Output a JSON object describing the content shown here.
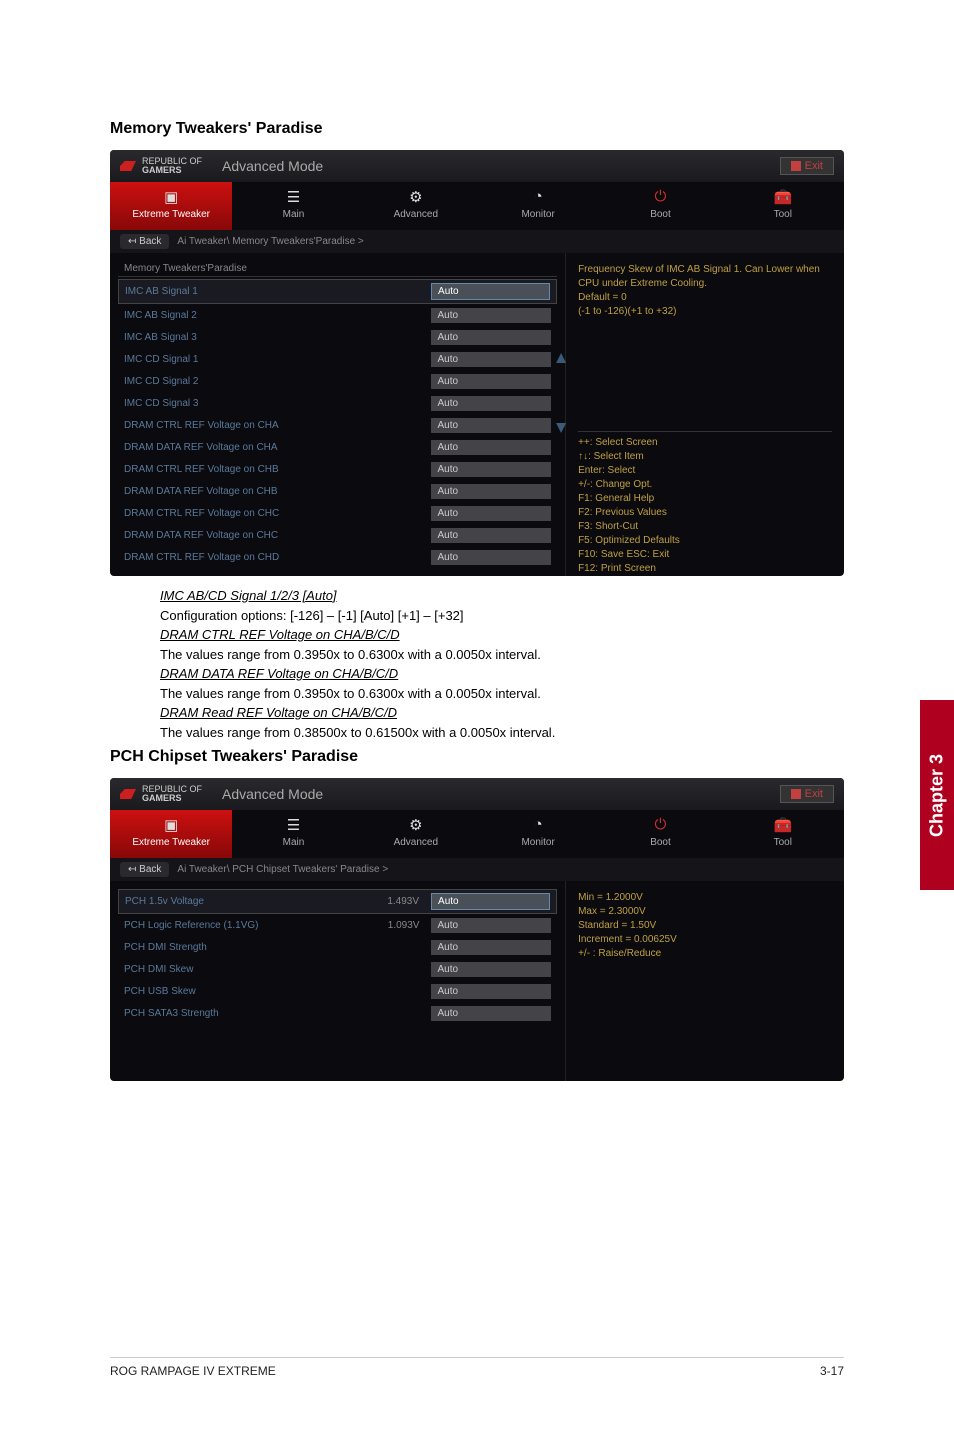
{
  "section1_title": "Memory Tweakers' Paradise",
  "section2_title": "PCH Chipset Tweakers' Paradise",
  "bios_brand_line1": "REPUBLIC OF",
  "bios_brand_line2": "GAMERS",
  "mode_label": "Advanced Mode",
  "exit_label": "Exit",
  "tabs": [
    {
      "label": "Extreme Tweaker",
      "active": true
    },
    {
      "label": "Main",
      "active": false
    },
    {
      "label": "Advanced",
      "active": false
    },
    {
      "label": "Monitor",
      "active": false
    },
    {
      "label": "Boot",
      "active": false
    },
    {
      "label": "Tool",
      "active": false
    }
  ],
  "back_label": "Back",
  "breadcrumb1": "Ai Tweaker\\ Memory Tweakers'Paradise >",
  "breadcrumb2": "Ai Tweaker\\ PCH Chipset Tweakers' Paradise >",
  "group1_header": "Memory Tweakers'Paradise",
  "mem_settings": [
    {
      "label": "IMC AB Signal 1",
      "value": "Auto",
      "selected": true
    },
    {
      "label": "IMC AB Signal 2",
      "value": "Auto"
    },
    {
      "label": "IMC AB Signal 3",
      "value": "Auto"
    },
    {
      "label": "IMC CD Signal 1",
      "value": "Auto"
    },
    {
      "label": "IMC CD Signal 2",
      "value": "Auto"
    },
    {
      "label": "IMC CD Signal 3",
      "value": "Auto"
    },
    {
      "label": "DRAM CTRL REF Voltage on CHA",
      "value": "Auto"
    },
    {
      "label": "DRAM DATA REF Voltage on CHA",
      "value": "Auto"
    },
    {
      "label": "DRAM CTRL REF Voltage on CHB",
      "value": "Auto"
    },
    {
      "label": "DRAM DATA REF Voltage on CHB",
      "value": "Auto"
    },
    {
      "label": "DRAM CTRL REF Voltage on CHC",
      "value": "Auto"
    },
    {
      "label": "DRAM DATA REF Voltage on CHC",
      "value": "Auto"
    },
    {
      "label": "DRAM CTRL REF Voltage on CHD",
      "value": "Auto"
    }
  ],
  "help1_top": "Frequency Skew of IMC AB Signal 1. Can Lower when CPU under Extreme Cooling.\nDefault = 0\n (-1 to -126)(+1 to +32)",
  "help_keys": "++: Select Screen\n↑↓: Select Item\nEnter: Select\n+/-: Change Opt.\nF1: General Help\nF2: Previous Values\nF3: Short-Cut\nF5: Optimized Defaults\nF10: Save  ESC: Exit\nF12: Print Screen",
  "pch_settings": [
    {
      "label": "PCH 1.5v Voltage",
      "mid": "1.493V",
      "value": "Auto",
      "selected": true
    },
    {
      "label": "PCH Logic Reference (1.1VG)",
      "mid": "1.093V",
      "value": "Auto"
    },
    {
      "label": "PCH DMI Strength",
      "mid": "",
      "value": "Auto"
    },
    {
      "label": "PCH DMI Skew",
      "mid": "",
      "value": "Auto"
    },
    {
      "label": "PCH USB Skew",
      "mid": "",
      "value": "Auto"
    },
    {
      "label": "PCH SATA3 Strength",
      "mid": "",
      "value": "Auto"
    }
  ],
  "help2_top": "Min = 1.2000V\nMax = 2.3000V\nStandard = 1.50V\nIncrement =  0.00625V\n+/- : Raise/Reduce",
  "desc": {
    "t1": "IMC AB/CD Signal 1/2/3 [Auto]",
    "d1": "Configuration options: [-126] – [-1] [Auto] [+1] – [+32]",
    "t2": "DRAM CTRL REF Voltage on CHA/B/C/D",
    "d2": "The values range from 0.3950x to 0.6300x with a 0.0050x interval.",
    "t3": "DRAM DATA REF Voltage on CHA/B/C/D",
    "d3": "The values range from 0.3950x to 0.6300x with a 0.0050x interval.",
    "t4": "DRAM Read REF Voltage on CHA/B/C/D",
    "d4": "The values range from 0.38500x to 0.61500x with a 0.0050x interval."
  },
  "chapter_tab": "Chapter 3",
  "footer_left": "ROG RAMPAGE IV EXTREME",
  "footer_right": "3-17"
}
